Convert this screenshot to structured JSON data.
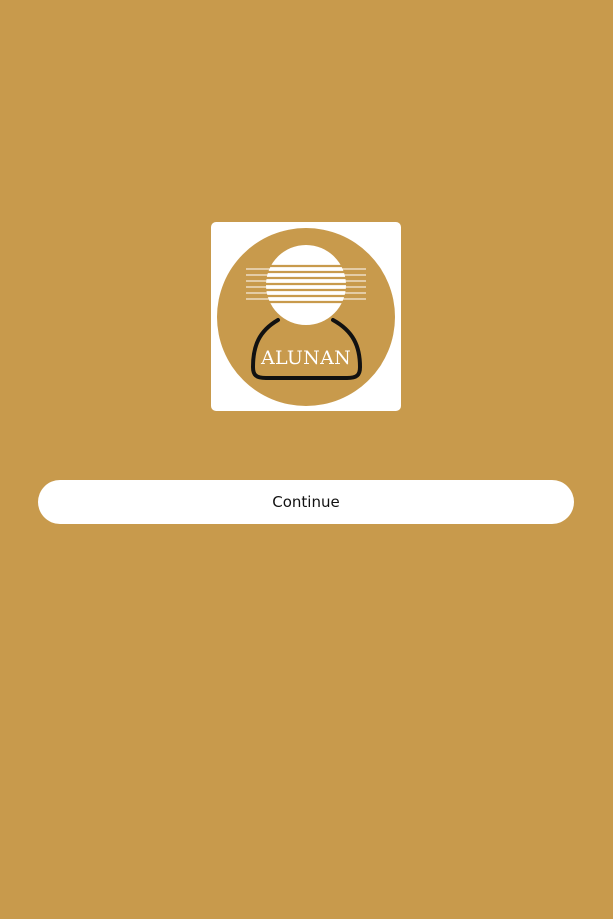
{
  "theme": {
    "background": "#C89A4C",
    "tile": "#FFFFFF",
    "logo_circle": "#C89A4C",
    "logo_figure": "#111111",
    "button_background": "#FFFFFF",
    "button_text": "#111111"
  },
  "logo": {
    "icon": "alunan-musician-logo",
    "wordmark": "ALUNAN"
  },
  "actions": {
    "continue_label": "Continue"
  }
}
